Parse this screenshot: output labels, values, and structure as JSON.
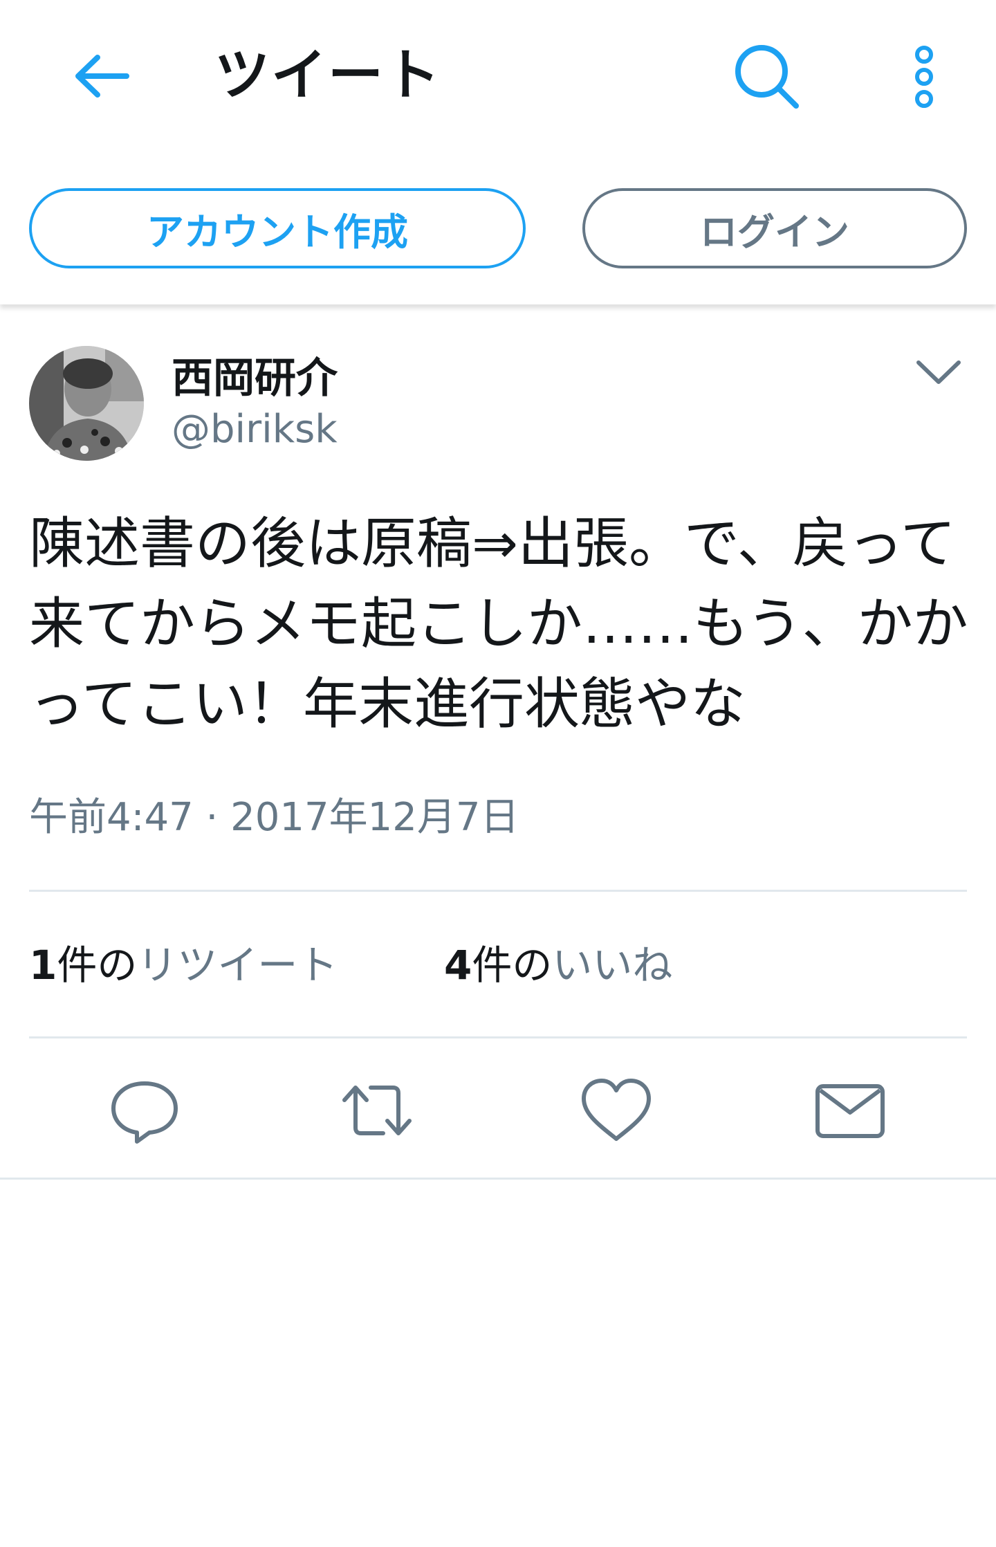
{
  "header": {
    "title": "ツイート",
    "back_icon": "back-arrow-icon",
    "search_icon": "search-icon",
    "more_icon": "more-vertical-icon",
    "signup_label": "アカウント作成",
    "login_label": "ログイン",
    "accent": "#1da1f2",
    "secondary": "#657786"
  },
  "tweet": {
    "author_name": "西岡研介",
    "author_handle": "@biriksk",
    "text": "陳述書の後は原稿⇒出張。で、戻って来てからメモ起こしか……もう、かかってこい！年末進行状態やな",
    "timestamp": "午前4:47 · 2017年12月7日",
    "retweets": {
      "count": "1",
      "unit": "件の",
      "label": "リツイート"
    },
    "likes": {
      "count": "4",
      "unit": "件の",
      "label": "いいね"
    }
  },
  "actions": [
    "reply-icon",
    "retweet-icon",
    "like-icon",
    "message-icon"
  ]
}
